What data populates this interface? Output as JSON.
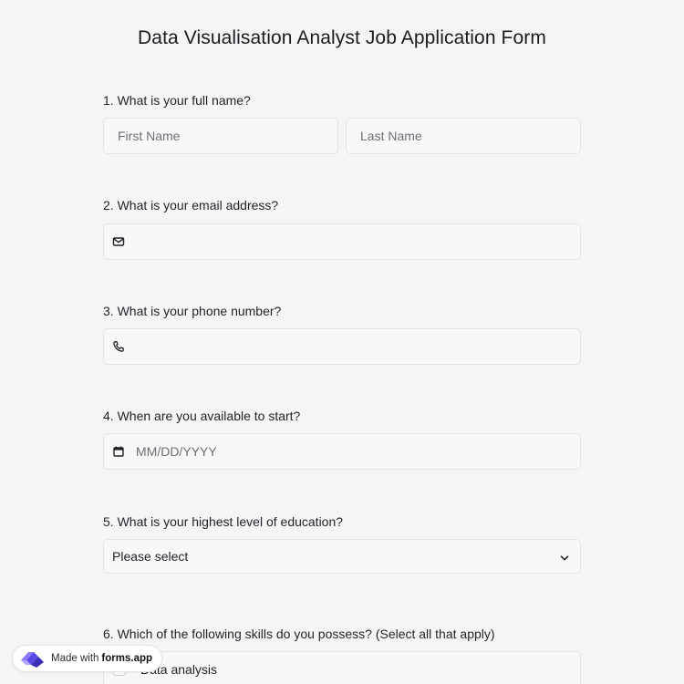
{
  "form": {
    "title": "Data Visualisation Analyst Job Application Form"
  },
  "questions": {
    "q1": {
      "label": "1.  What is your full name?",
      "first_placeholder": "First Name",
      "last_placeholder": "Last Name"
    },
    "q2": {
      "label": "2. What is your email address?",
      "icon": "mail-icon"
    },
    "q3": {
      "label": "3. What is your phone number?",
      "icon": "phone-icon"
    },
    "q4": {
      "label": "4. When are you available to start?",
      "placeholder": "MM/DD/YYYY",
      "icon": "calendar-icon"
    },
    "q5": {
      "label": "5. What is your highest level of education?",
      "selected": "Please select",
      "icon": "chevron-down-icon"
    },
    "q6": {
      "label": "6. Which of the following skills do you possess? (Select all that apply)",
      "options": [
        "Data analysis"
      ]
    }
  },
  "badge": {
    "made_with": "Made with",
    "brand": "forms.app"
  },
  "colors": {
    "background": "#f5f5f6",
    "field_bg": "#f8f8f9",
    "field_border": "#e3e4e7",
    "logo_purple": "#6b5cf0"
  }
}
